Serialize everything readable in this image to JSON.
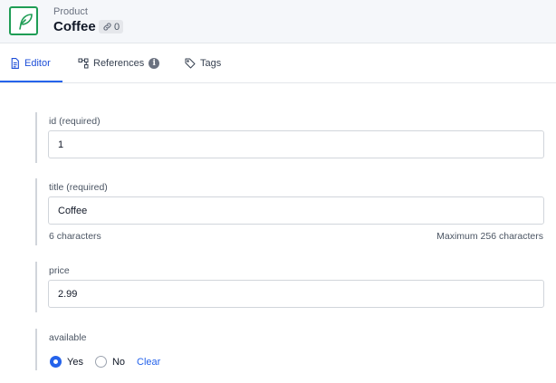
{
  "header": {
    "doc_type": "Product",
    "title": "Coffee",
    "ref_count": "0",
    "doc_icon": "feather-icon",
    "link_icon": "link-icon"
  },
  "tabs": [
    {
      "label": "Editor",
      "icon": "document-icon",
      "active": true
    },
    {
      "label": "References",
      "icon": "references-icon"
    },
    {
      "label": "Tags",
      "icon": "tag-icon"
    }
  ],
  "fields": {
    "id": {
      "label": "id (required)",
      "value": "1"
    },
    "title": {
      "label": "title (required)",
      "value": "Coffee",
      "char_count": "6 characters",
      "max_chars": "Maximum 256 characters"
    },
    "price": {
      "label": "price",
      "value": "2.99"
    },
    "available": {
      "label": "available",
      "options": [
        "Yes",
        "No"
      ],
      "selected": "Yes",
      "clear_label": "Clear"
    }
  },
  "colors": {
    "accent": "#2563eb",
    "brand": "#1f9d55"
  }
}
